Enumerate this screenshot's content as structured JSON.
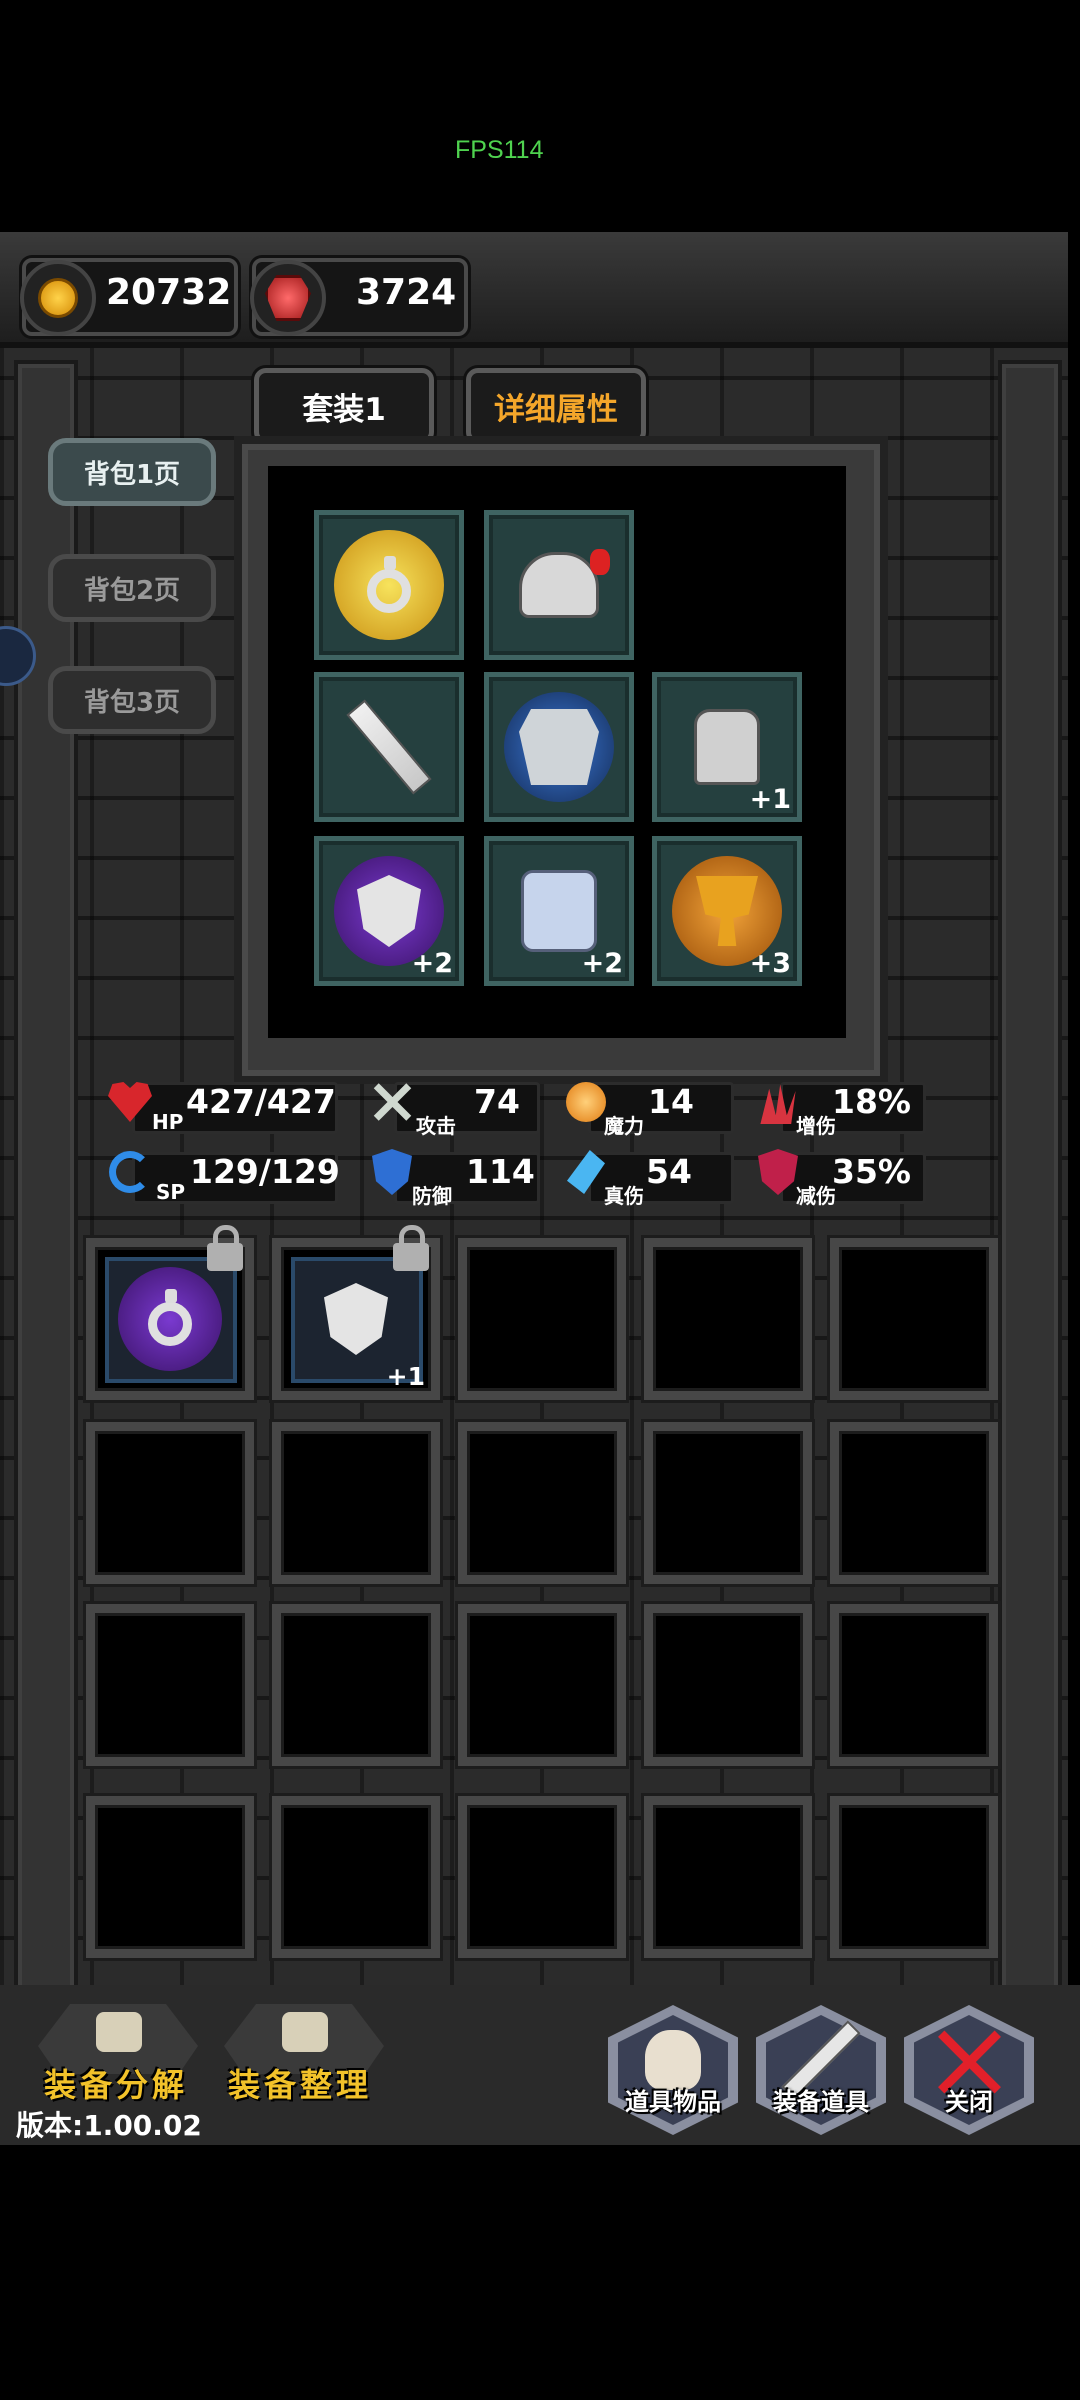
{
  "fps_label": "FPS114",
  "currency": {
    "gold": "20732",
    "gems": "3724"
  },
  "set_tabs": [
    "套装1",
    "详细属性"
  ],
  "pages": [
    "背包1页",
    "背包2页",
    "背包3页"
  ],
  "equipment": [
    {
      "name": "gold-ring",
      "icon": "ring-icon",
      "plus": ""
    },
    {
      "name": "helmet",
      "icon": "helmet-icon",
      "plus": ""
    },
    {
      "name": "sword",
      "icon": "sword-icon",
      "plus": ""
    },
    {
      "name": "armor",
      "icon": "armor-icon",
      "plus": ""
    },
    {
      "name": "gauntlet",
      "icon": "gauntlet-icon",
      "plus": "+1"
    },
    {
      "name": "shield",
      "icon": "shield-icon",
      "plus": "+2"
    },
    {
      "name": "boots",
      "icon": "boots-icon",
      "plus": "+2"
    },
    {
      "name": "trophy",
      "icon": "trophy-icon",
      "plus": "+3"
    }
  ],
  "stats": {
    "hp": {
      "label": "HP",
      "value": "427/427"
    },
    "attack": {
      "label": "攻击",
      "value": "74"
    },
    "magic": {
      "label": "魔力",
      "value": "14"
    },
    "dmg_up": {
      "label": "增伤",
      "value": "18%"
    },
    "sp": {
      "label": "SP",
      "value": "129/129"
    },
    "defense": {
      "label": "防御",
      "value": "114"
    },
    "true_dmg": {
      "label": "真伤",
      "value": "54"
    },
    "dmg_down": {
      "label": "减伤",
      "value": "35%"
    }
  },
  "backpack": [
    {
      "icon": "purple-ring-icon",
      "plus": "",
      "locked": true
    },
    {
      "icon": "shield-icon",
      "plus": "+1",
      "locked": true
    }
  ],
  "buttons": {
    "decompose": "装备分解",
    "sort": "装备整理",
    "items": "道具物品",
    "equip_items": "装备道具",
    "close": "关闭"
  },
  "version": "版本:1.00.02",
  "colors": {
    "fps": "#4fd24f",
    "gold_text": "#f4a62a",
    "forge_text": "#f2c22a",
    "close_x": "#e2202a"
  }
}
